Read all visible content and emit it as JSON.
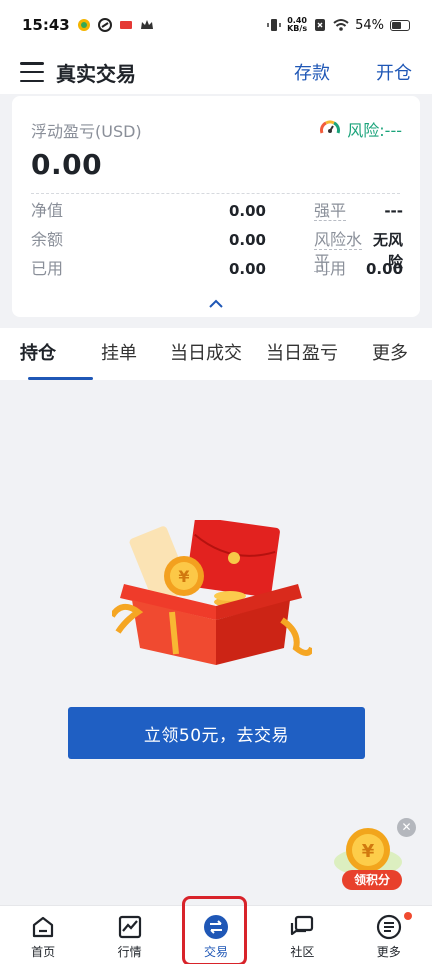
{
  "status_bar": {
    "time": "15:43",
    "net_speed_top": "0.40",
    "net_speed_bottom": "KB/s",
    "battery": "54%"
  },
  "header": {
    "title": "真实交易",
    "deposit_label": "存款",
    "open_label": "开仓"
  },
  "account": {
    "pnl_label": "浮动盈亏(USD)",
    "pnl_value": "0.00",
    "risk_label": "风险:---",
    "metrics": [
      {
        "label": "净值",
        "value": "0.00",
        "label2": "强平",
        "value2": "---"
      },
      {
        "label": "余额",
        "value": "0.00",
        "label2": "风险水平",
        "value2": "无风险"
      },
      {
        "label": "已用",
        "value": "0.00",
        "label2": "可用",
        "value2": "0.00"
      }
    ]
  },
  "tabs": [
    "持仓",
    "挂单",
    "当日成交",
    "当日盈亏",
    "更多"
  ],
  "empty_state": {
    "cta_label": "立领50元，去交易"
  },
  "points_widget": {
    "label": "领积分",
    "coin_symbol": "¥"
  },
  "bottom_nav": [
    {
      "label": "首页",
      "icon": "home-icon"
    },
    {
      "label": "行情",
      "icon": "chart-icon"
    },
    {
      "label": "交易",
      "icon": "exchange-icon"
    },
    {
      "label": "社区",
      "icon": "chat-icon"
    },
    {
      "label": "更多",
      "icon": "more-icon"
    }
  ],
  "colors": {
    "accent": "#1f57b6",
    "risk_green": "#1aa37a",
    "highlight_red": "#d8232a"
  }
}
